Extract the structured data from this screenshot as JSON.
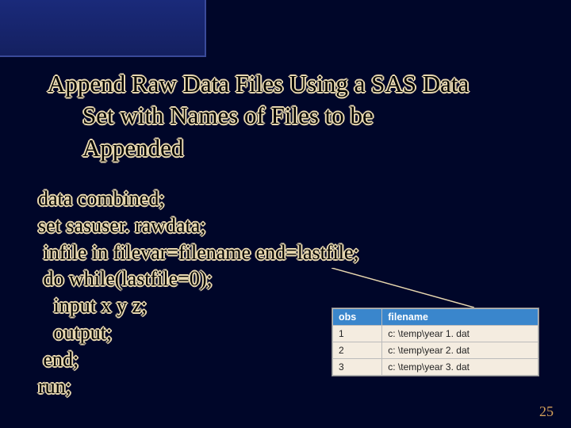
{
  "title": {
    "line1": "Append Raw Data Files Using a SAS Data",
    "line2": "Set with Names of Files to be",
    "line3": "Appended"
  },
  "code": {
    "l1": "data combined;",
    "l2": "set sasuser. rawdata;",
    "l3": " infile in filevar=filename end=lastfile;",
    "l4": " do while(lastfile=0);",
    "l5": "   input x y z;",
    "l6": "   output;",
    "l7": " end;",
    "l8": "run;"
  },
  "table": {
    "headers": {
      "col1": "obs",
      "col2": "filename"
    },
    "rows": [
      {
        "col1": "1",
        "col2": "c: \\temp\\year 1. dat"
      },
      {
        "col1": "2",
        "col2": "c: \\temp\\year 2. dat"
      },
      {
        "col1": "3",
        "col2": "c: \\temp\\year 3. dat"
      }
    ]
  },
  "pagenum": "25"
}
